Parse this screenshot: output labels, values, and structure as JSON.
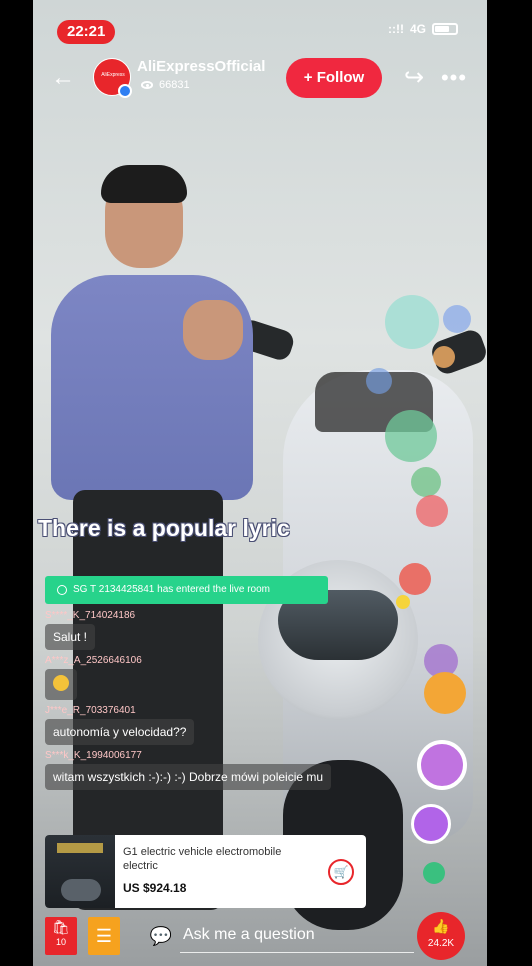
{
  "status_bar": {
    "time": "22:21",
    "network": "4G",
    "signal_glyph": "::!!"
  },
  "header": {
    "back_glyph": "←",
    "channel_name": "AliExpressOfficial",
    "avatar_text": "AliExpress",
    "viewer_count": "66831",
    "follow_label": "+ Follow",
    "share_glyph": "↪",
    "more_glyph": "•••"
  },
  "live": {
    "caption": "There is a popular lyric",
    "entered_text": "SG T 2134425841 has entered the live room"
  },
  "chat": [
    {
      "user": "S****_K_714024186",
      "message": "Salut !"
    },
    {
      "user": "A***z_A_2526646106",
      "message": ""
    },
    {
      "user": "J***e_R_703376401",
      "message": "autonomía y velocidad??"
    },
    {
      "user": "S***k_K_1994006177",
      "message": "witam wszystkich :-):-) :-)  Dobrze mówi poleicie mu"
    }
  ],
  "product": {
    "title": "G1 electric vehicle electromobile electric",
    "price": "US $924.18",
    "cart_glyph": "🛒"
  },
  "bottom_bar": {
    "bag_icon_glyph": "🛍",
    "bag_count": "10",
    "list_icon_glyph": "☰",
    "ask_icon_glyph": "💬",
    "ask_placeholder": "Ask me a question",
    "like_icon_glyph": "👍",
    "like_count": "24.2K"
  },
  "colors": {
    "accent_red": "#e8262b",
    "follow_red": "#f0283f",
    "entered_green": "#27d38b",
    "list_orange": "#f6a21e"
  },
  "icons": {
    "back": "back-arrow-icon",
    "share": "share-icon",
    "more": "more-icon",
    "cart": "cart-icon",
    "bag": "shopping-bag-icon",
    "list": "list-icon",
    "ask": "chat-bubble-icon",
    "like": "like-icon"
  }
}
